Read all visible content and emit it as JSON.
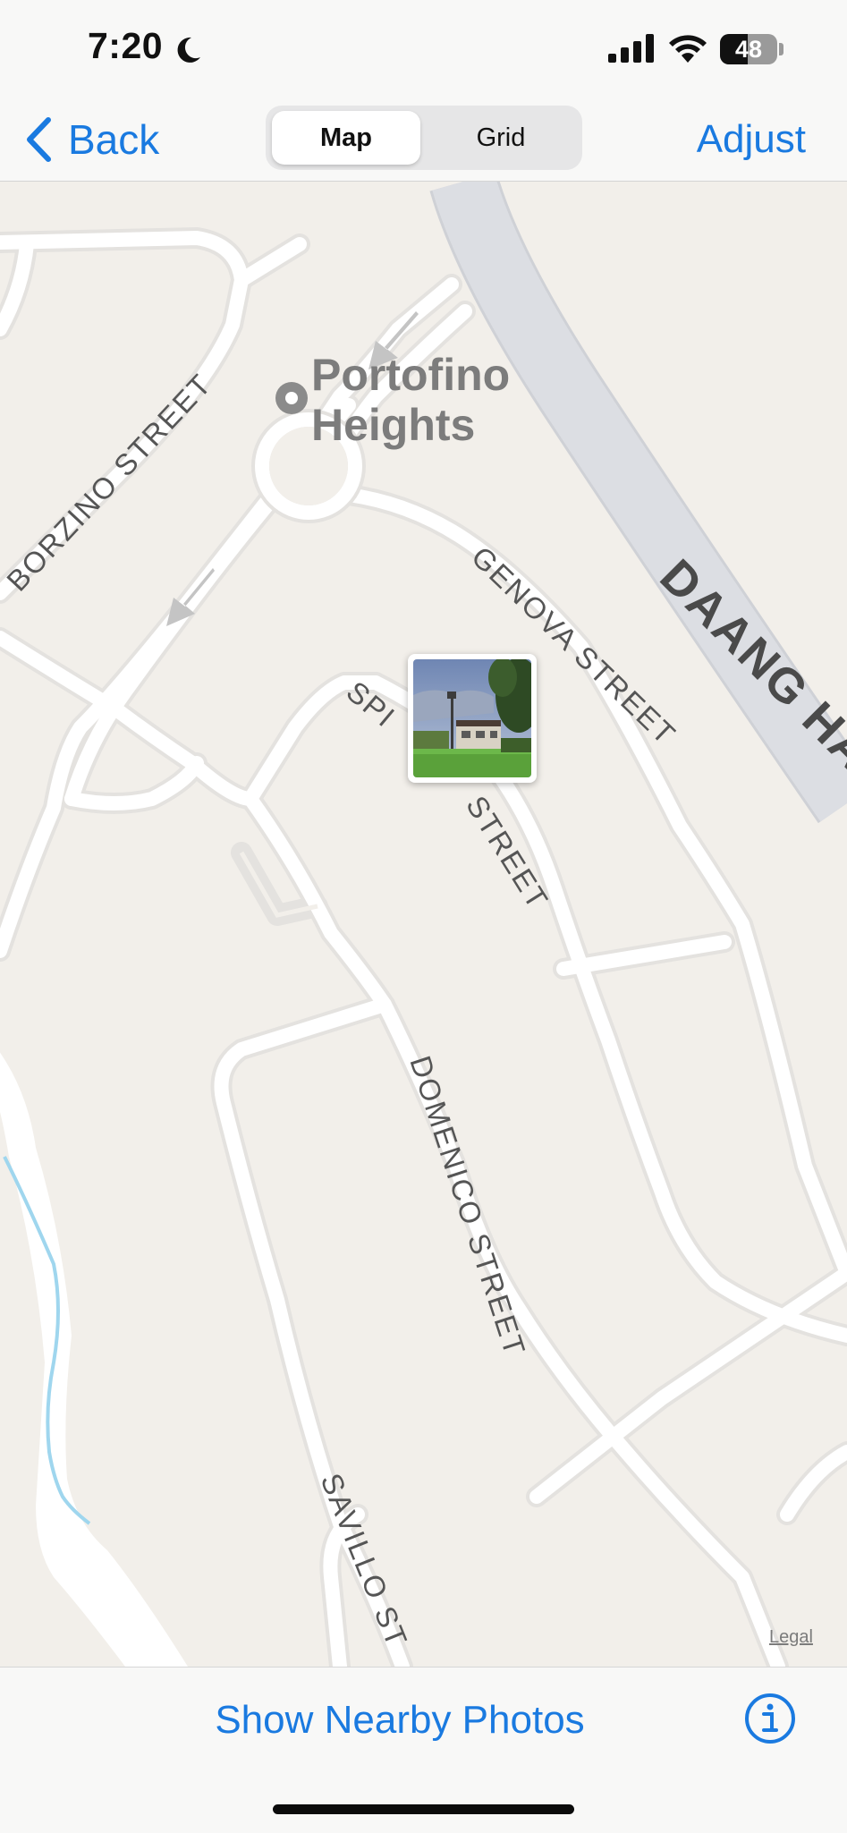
{
  "status_bar": {
    "time": "7:20",
    "battery": "48",
    "battery_level": 0.48,
    "icons": [
      "moon-icon",
      "cellular-signal-icon",
      "wifi-icon",
      "battery-icon"
    ]
  },
  "nav": {
    "back_label": "Back",
    "segments": [
      "Map",
      "Grid"
    ],
    "selected_segment": "Map",
    "adjust_label": "Adjust"
  },
  "map": {
    "poi_name_line1": "Portofino",
    "poi_name_line2": "Heights",
    "streets": {
      "borzino": "BORZINO STREET",
      "genova": "GENOVA STREET",
      "daang": "DAANG HAR",
      "spi_a": "SPI",
      "spi_b": "STREET",
      "domenico": "DOMENICO STREET",
      "savillo": "SAVILLO ST"
    },
    "legal": "Legal"
  },
  "bottom": {
    "nearby_label": "Show Nearby Photos",
    "info_icon": "info-icon"
  },
  "colors": {
    "accent": "#1a7ae0",
    "map_background": "#f2efea",
    "road": "#ffffff",
    "highway": "#d9dbe0",
    "water": "#9fd6ee"
  }
}
